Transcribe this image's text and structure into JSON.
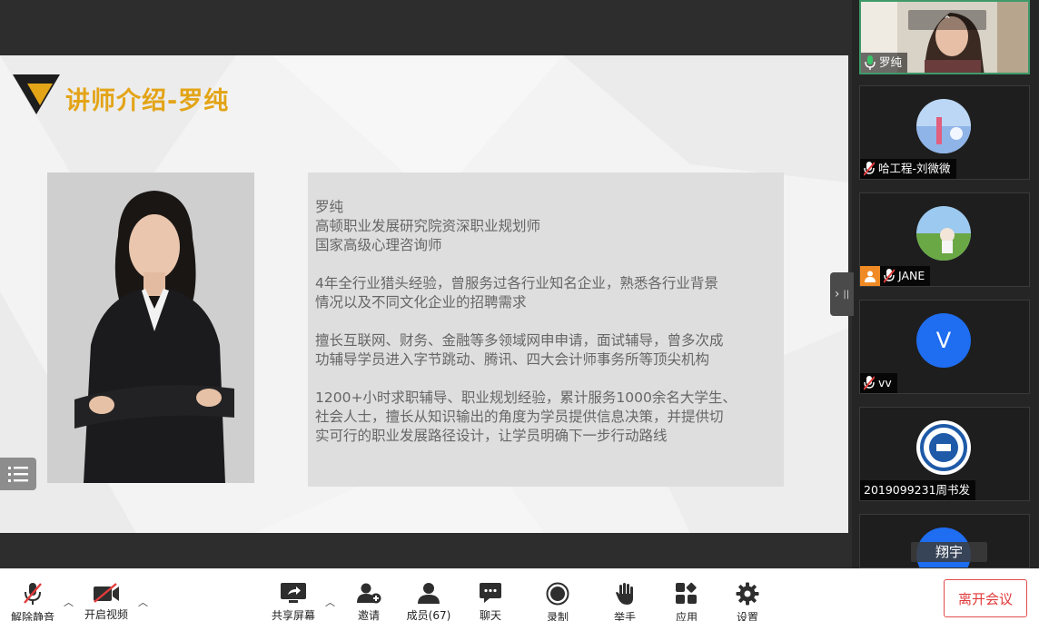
{
  "slide": {
    "title": "讲师介绍-罗纯",
    "bio_lines": [
      "罗纯",
      "高顿职业发展研究院资深职业规划师",
      "国家高级心理咨询师",
      "",
      "4年全行业猎头经验，曾服务过各行业知名企业，熟悉各行业背景",
      "情况以及不同文化企业的招聘需求",
      "",
      "擅长互联网、财务、金融等多领域网申申请，面试辅导，曾多次成",
      "功辅导学员进入字节跳动、腾讯、四大会计师事务所等顶尖机构",
      "",
      "1200+小时求职辅导、职业规划经验，累计服务1000余名大学生、",
      "社会人士，擅长从知识输出的角度为学员提供信息决策，并提供切",
      "实可行的职业发展路径设计，让学员明确下一步行动路线"
    ]
  },
  "participants": [
    {
      "name": "罗纯",
      "type": "video",
      "muted": false
    },
    {
      "name": "哈工程-刘微微",
      "type": "photo",
      "muted": true
    },
    {
      "name": "JANE",
      "type": "photo",
      "muted": true
    },
    {
      "name": "vv",
      "type": "letter",
      "letter": "V",
      "muted": true
    },
    {
      "name": "2019099231周书发",
      "type": "logo",
      "muted": false
    },
    {
      "name": "翔宇",
      "type": "partial",
      "muted": false
    }
  ],
  "toolbar": {
    "unmute": "解除静音",
    "start_video": "开启视频",
    "share_screen": "共享屏幕",
    "invite": "邀请",
    "members": "成员(67)",
    "chat": "聊天",
    "record": "录制",
    "raise_hand": "举手",
    "apps": "应用",
    "settings": "设置",
    "leave": "离开会议"
  },
  "colors": {
    "accent_gold": "#e3a417",
    "active_border": "#3f9a6a",
    "leave_red": "#e03a3a",
    "avatar_blue": "#1f6df0"
  }
}
